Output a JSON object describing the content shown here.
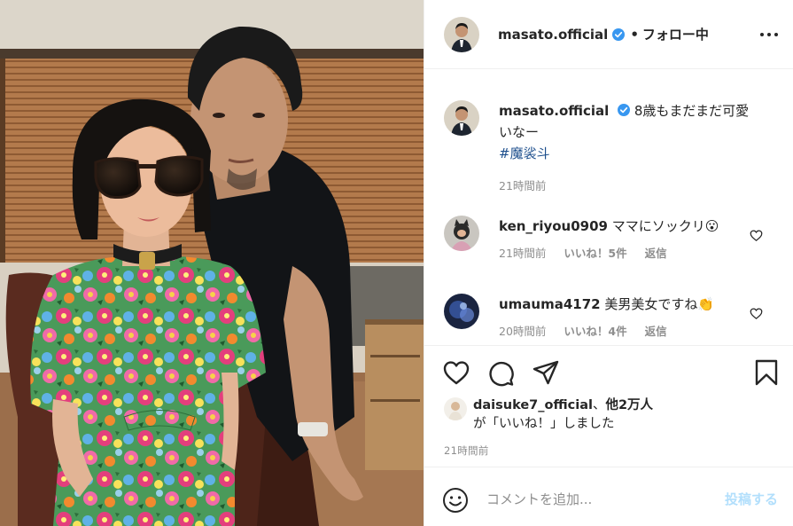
{
  "post": {
    "author": "masato.official",
    "separator": "•",
    "follow_status": "フォロー中",
    "more_icon": "more-horizontal-icon",
    "caption": {
      "username": "masato.official",
      "text_line1": "8歳もまだまだ可愛",
      "text_line2": "いなー",
      "hashtag": "#魔裟斗",
      "time": "21時間前"
    },
    "comments": [
      {
        "username": "ken_riyou0909",
        "text": "ママにソックリ😮",
        "time": "21時間前",
        "likes": "いいね！5件",
        "reply": "返信"
      },
      {
        "username": "umauma4172",
        "text": "美男美女ですね👏",
        "time": "20時間前",
        "likes": "いいね！4件",
        "reply": "返信"
      }
    ],
    "actions": {
      "icons": [
        "heart-icon",
        "comment-icon",
        "share-icon",
        "bookmark-icon"
      ]
    },
    "likes": {
      "liked_by": "daisuke7_official",
      "connector": "、",
      "others": "他2万人",
      "suffix": "が「いいね！」しました"
    },
    "timestamp": "21時間前",
    "comment_box": {
      "placeholder": "コメントを追加...",
      "post_label": "投稿する"
    }
  },
  "colors": {
    "text": "#262626",
    "secondary": "#8e8e8e",
    "link": "#1c4e8c",
    "verified": "#3897f0",
    "post_disabled": "#b2dffc",
    "border": "#efefef"
  }
}
